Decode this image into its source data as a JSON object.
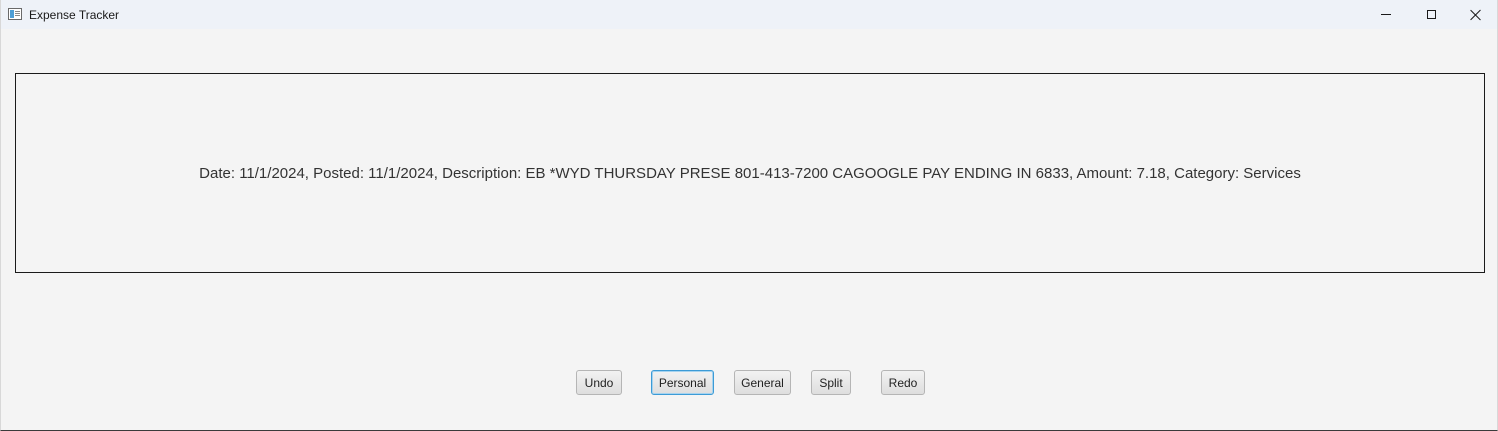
{
  "window": {
    "title": "Expense Tracker",
    "icon": "app-window-icon",
    "controls": {
      "minimize_icon": "minimize-icon",
      "maximize_icon": "maximize-icon",
      "close_icon": "close-icon"
    }
  },
  "record": {
    "text": "Date: 11/1/2024, Posted: 11/1/2024, Description: EB *WYD THURSDAY PRESE 801-413-7200 CAGOOGLE PAY ENDING IN 6833, Amount: 7.18, Category: Services"
  },
  "actions": {
    "undo": "Undo",
    "personal": "Personal",
    "general": "General",
    "split": "Split",
    "redo": "Redo",
    "focused": "Personal"
  },
  "colors": {
    "focus_border": "#3c9bd6",
    "background": "#f4f4f4",
    "titlebar": "#eef2f8"
  }
}
